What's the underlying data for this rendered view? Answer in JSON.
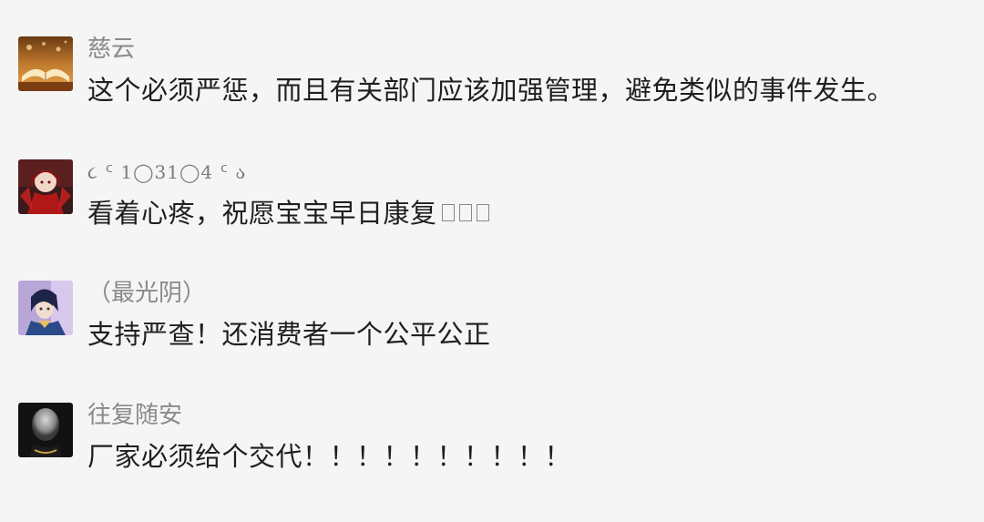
{
  "comments": [
    {
      "author": "慈云",
      "avatar": "book-avatar-icon",
      "text": "这个必须严惩，而且有关部门应该加强管理，避免类似的事件发生。"
    },
    {
      "author": "૮ ᑦ 1◯31◯4 ᑦ ა",
      "avatar": "anime-girl-red-avatar-icon",
      "text": "看着心疼，祝愿宝宝早日康复",
      "trailing_glyphs": [
        "unknown-emoji-icon",
        "unknown-emoji-icon",
        "unknown-emoji-icon"
      ]
    },
    {
      "author": "（最光阴）",
      "avatar": "anime-boy-purple-avatar-icon",
      "text": "支持严查！还消费者一个公平公正"
    },
    {
      "author": "往复随安",
      "avatar": "dark-figure-avatar-icon",
      "text": "厂家必须给个交代！！！！！！！！！！"
    }
  ],
  "colors": {
    "background": "#f5f5f5",
    "author": "#8a8a8a",
    "text": "#1f1f1f"
  }
}
